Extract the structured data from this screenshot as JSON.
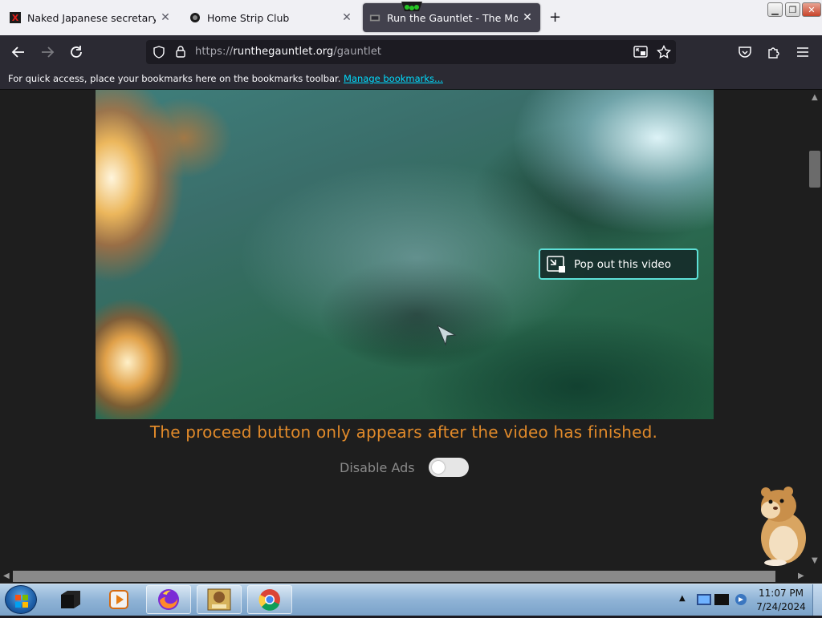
{
  "browser": {
    "tabs": [
      {
        "title": "Naked Japanese secretary get u",
        "favicon": "x-favicon-icon",
        "favicon_text": "X"
      },
      {
        "title": "Home Strip Club",
        "favicon": "circle-favicon-icon"
      },
      {
        "title": "Run the Gauntlet - The Most Di",
        "favicon": "gauntlet-favicon-icon"
      }
    ],
    "url": {
      "scheme": "https://",
      "host": "runthegauntlet.org",
      "path": "/gauntlet"
    },
    "bookmarks_bar": {
      "hint": "For quick access, place your bookmarks here on the bookmarks toolbar.",
      "manage_link": "Manage bookmarks..."
    },
    "theme": {
      "toolbar": "#2b2a33",
      "content_bg": "#1e1e1e",
      "accent": "#00ddff"
    }
  },
  "page": {
    "video": {
      "popout_label": "Pop out this video",
      "popout_border_color": "#5ee0d8"
    },
    "notice": "The proceed button only appears after the video has finished.",
    "notice_color": "#e18a2a",
    "ads": {
      "label": "Disable Ads",
      "enabled": false
    }
  },
  "taskbar": {
    "items": [
      "app-window-icon",
      "media-player-icon",
      "firefox-icon",
      "game-box-icon",
      "chrome-icon"
    ],
    "clock": {
      "time": "11:07 PM",
      "date": "7/24/2024"
    }
  }
}
